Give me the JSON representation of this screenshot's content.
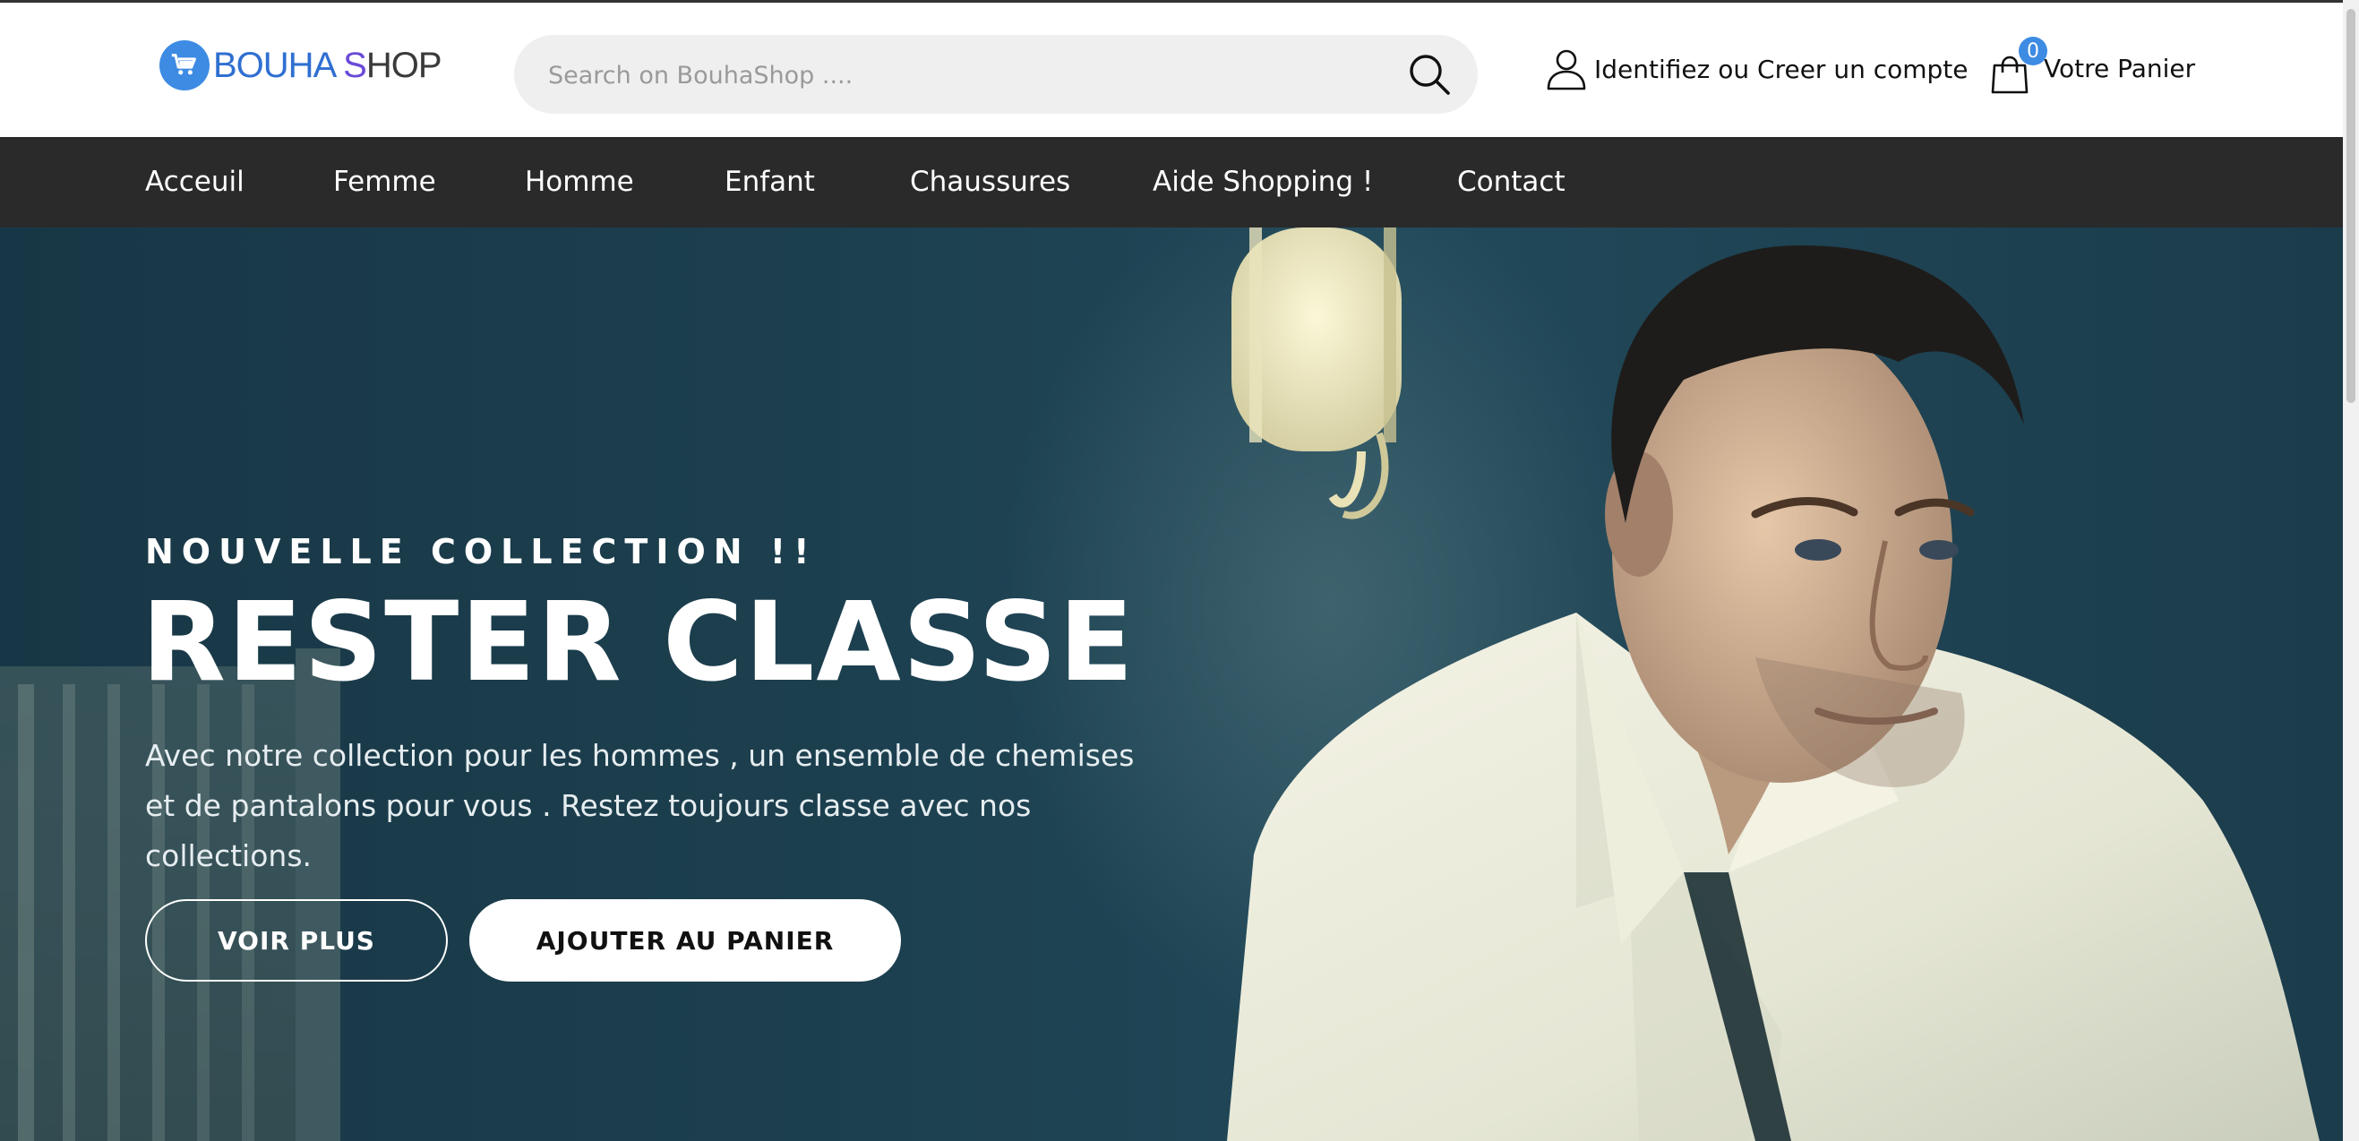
{
  "brand": {
    "name_part1": "BOUHA",
    "name_part2_s": "S",
    "name_part2_rest": "HOP",
    "logo_icon": "cart-icon",
    "accent_color": "#3d8be3"
  },
  "search": {
    "placeholder": "Search on BouhaShop ....",
    "value": "",
    "icon": "search-icon"
  },
  "account": {
    "icon": "user-icon",
    "label_strong1": "Identifiez",
    "label_mid": " ou ",
    "label_strong2": "Creer un compte"
  },
  "cart": {
    "icon": "shopping-bag-icon",
    "count": "0",
    "label": "Votre Panier"
  },
  "nav": {
    "items": [
      {
        "label": "Acceuil"
      },
      {
        "label": "Femme"
      },
      {
        "label": "Homme"
      },
      {
        "label": "Enfant"
      },
      {
        "label": "Chaussures"
      },
      {
        "label": "Aide Shopping !"
      },
      {
        "label": "Contact"
      }
    ],
    "background": "#2a2a2a"
  },
  "hero": {
    "eyebrow": "NOUVELLE COLLECTION !!",
    "title": "RESTER CLASSE",
    "description": "Avec notre collection pour les hommes , un ensemble de chemises et de pantalons pour vous . Restez toujours classe avec nos collections.",
    "primary_button": "VOIR PLUS",
    "secondary_button": "AJOUTER AU PANIER"
  }
}
